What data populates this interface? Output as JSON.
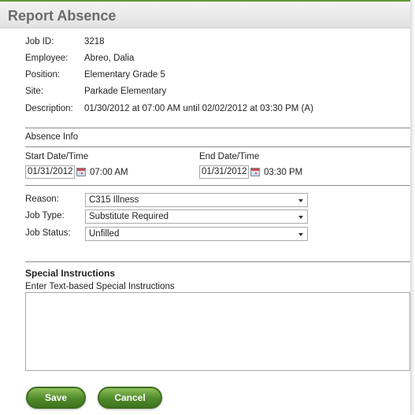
{
  "header": {
    "title": "Report Absence"
  },
  "job_info": [
    {
      "label": "Job ID:",
      "value": "3218"
    },
    {
      "label": "Employee:",
      "value": "Abreo, Dalia"
    },
    {
      "label": "Position:",
      "value": "Elementary Grade 5"
    },
    {
      "label": "Site:",
      "value": "Parkade Elementary"
    },
    {
      "label": "Description:",
      "value": "01/30/2012 at 07:00 AM until 02/02/2012 at 03:30 PM (A)"
    }
  ],
  "absence_info": {
    "section_label": "Absence Info",
    "start": {
      "label": "Start Date/Time",
      "date": "01/31/2012",
      "time": "07:00 AM"
    },
    "end": {
      "label": "End Date/Time",
      "date": "01/31/2012",
      "time": "03:30 PM"
    }
  },
  "selects": {
    "reason": {
      "label": "Reason:",
      "value": "C315 Illness"
    },
    "job_type": {
      "label": "Job Type:",
      "value": "Substitute Required"
    },
    "job_status": {
      "label": "Job Status:",
      "value": "Unfilled"
    }
  },
  "special_instructions": {
    "title": "Special Instructions",
    "subtitle": "Enter Text-based Special Instructions",
    "value": ""
  },
  "buttons": {
    "save": "Save",
    "cancel": "Cancel"
  },
  "colors": {
    "accent": "#5f9937",
    "button_green": "#4f8a2a"
  }
}
